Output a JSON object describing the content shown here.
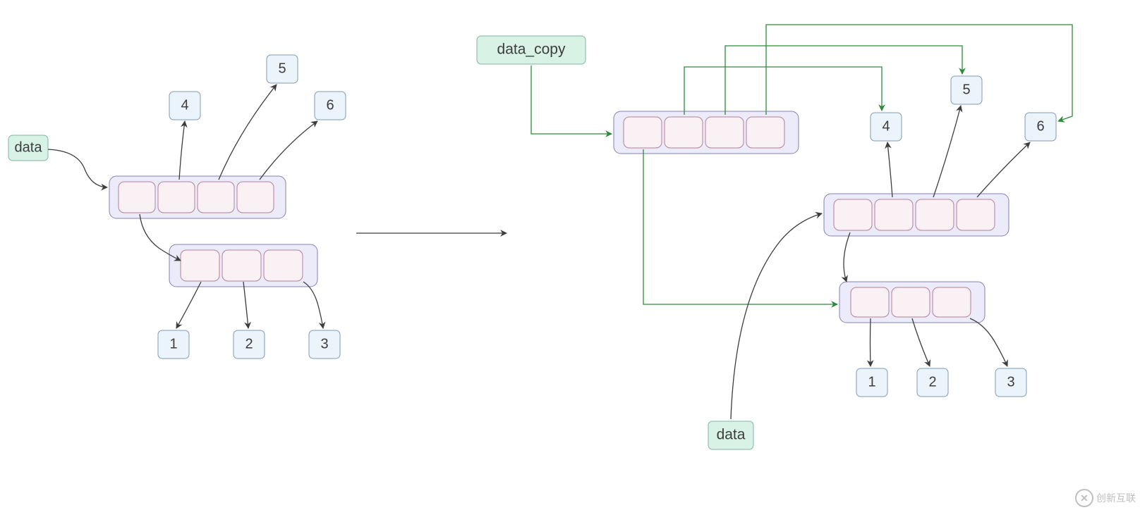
{
  "left": {
    "data_label": "data",
    "numbers": {
      "n1": "1",
      "n2": "2",
      "n3": "3",
      "n4": "4",
      "n5": "5",
      "n6": "6"
    }
  },
  "right": {
    "data_label": "data",
    "data_copy_label": "data_copy",
    "numbers": {
      "n1": "1",
      "n2": "2",
      "n3": "3",
      "n4": "4",
      "n5": "5",
      "n6": "6"
    }
  },
  "watermark": "创新互联"
}
